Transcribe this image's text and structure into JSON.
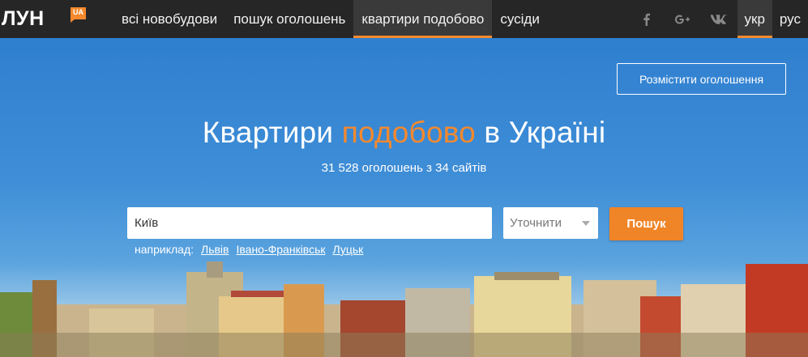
{
  "logo": {
    "text": "ЛУН",
    "badge": "UA"
  },
  "nav": {
    "items": [
      {
        "label": "всі новобудови",
        "active": false
      },
      {
        "label": "пошук оголошень",
        "active": false
      },
      {
        "label": "квартири подобово",
        "active": true
      },
      {
        "label": "сусіди",
        "active": false
      }
    ]
  },
  "social": {
    "facebook": "f",
    "googleplus": "g+",
    "vk": "vk"
  },
  "lang": {
    "ukr": "укр",
    "rus": "рус",
    "active": "укр"
  },
  "hero": {
    "post_ad_label": "Розмістити оголошення",
    "headline_pre": "Квартири ",
    "headline_accent": "подобово",
    "headline_post": " в Україні",
    "subline": "31 528 оголошень з 34 сайтів"
  },
  "search": {
    "city_value": "Київ",
    "refine_label": "Уточнити",
    "button_label": "Пошук",
    "examples_label": "наприклад:",
    "examples": [
      "Львів",
      "Івано-Франківськ",
      "Луцьк"
    ]
  },
  "colors": {
    "accent": "#f5892d",
    "topbar": "#262626",
    "sky": "#3f8ad1"
  }
}
